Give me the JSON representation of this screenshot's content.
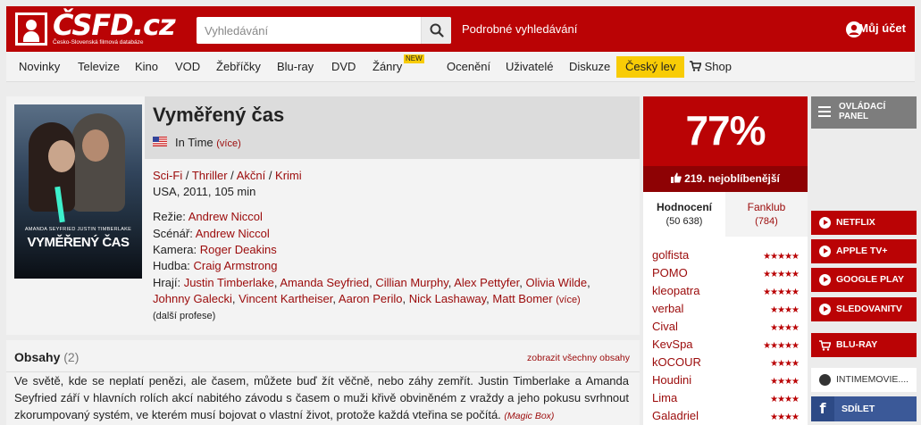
{
  "header": {
    "logo_text": "ČSFD.cz",
    "logo_sub": "Česko-Slovenská filmová databáze",
    "search_placeholder": "Vyhledávání",
    "advanced_search": "Podrobné vyhledávání",
    "account": "Můj účet"
  },
  "nav": {
    "items": [
      "Novinky",
      "Televize",
      "Kino",
      "VOD",
      "Žebříčky",
      "Blu-ray",
      "DVD",
      "Žánry",
      "Ocenění",
      "Uživatelé",
      "Diskuze",
      "Český lev",
      "Shop"
    ],
    "new_badge": "NEW"
  },
  "film": {
    "title": "Vyměřený čas",
    "original_title": "In Time",
    "more": "(více)",
    "genres": [
      "Sci-Fi",
      "Thriller",
      "Akční",
      "Krimi"
    ],
    "origin": "USA, 2011, 105 min",
    "poster_actors": "AMANDA SEYFRIED       JUSTIN TIMBERLAKE",
    "poster_title": "VYMĚŘENÝ ČAS",
    "crew": [
      {
        "role": "Režie:",
        "names": [
          "Andrew Niccol"
        ]
      },
      {
        "role": "Scénář:",
        "names": [
          "Andrew Niccol"
        ]
      },
      {
        "role": "Kamera:",
        "names": [
          "Roger Deakins"
        ]
      },
      {
        "role": "Hudba:",
        "names": [
          "Craig Armstrong"
        ]
      }
    ],
    "cast_label": "Hrají:",
    "cast": [
      "Justin Timberlake",
      "Amanda Seyfried",
      "Cillian Murphy",
      "Alex Pettyfer",
      "Olivia Wilde",
      "Johnny Galecki",
      "Vincent Kartheiser",
      "Aaron Perilo",
      "Nick Lashaway",
      "Matt Bomer"
    ],
    "cast_more": "(více)",
    "more_professions": "(další profese)"
  },
  "plot": {
    "title": "Obsahy",
    "count": "(2)",
    "show_all": "zobrazit všechny obsahy",
    "text": "Ve světě, kde se neplatí penězi, ale časem, můžete buď žít věčně, nebo záhy zemřít. Justin Timberlake a Amanda Seyfried září v hlavních rolích akcí nabitého závodu s časem o muži křivě obviněném z vraždy a jeho pokusu svrhnout zkorumpovaný systém, ve kterém musí bojovat o vlastní život, protože každá vteřina se počítá.",
    "source": "(Magic Box)"
  },
  "rating": {
    "score": "77%",
    "rank": "219. nejoblíbenější",
    "tabs": [
      {
        "label": "Hodnocení",
        "count": "(50 638)"
      },
      {
        "label": "Fanklub",
        "count": "(784)"
      }
    ],
    "users": [
      {
        "name": "golfista",
        "stars": 5
      },
      {
        "name": "POMO",
        "stars": 5
      },
      {
        "name": "kleopatra",
        "stars": 5
      },
      {
        "name": "verbal",
        "stars": 4
      },
      {
        "name": "Cival",
        "stars": 4
      },
      {
        "name": "KevSpa",
        "stars": 5
      },
      {
        "name": "kOCOUR",
        "stars": 4
      },
      {
        "name": "Houdini",
        "stars": 4
      },
      {
        "name": "Lima",
        "stars": 4
      },
      {
        "name": "Galadriel",
        "stars": 4
      }
    ]
  },
  "side": {
    "control_panel": "OVLÁDACÍ PANEL",
    "vod": [
      "NETFLIX",
      "APPLE TV+",
      "GOOGLE PLAY",
      "SLEDOVANITV"
    ],
    "bluray": "BLU-RAY",
    "intime": "INTIMEMOVIE....",
    "share": "SDÍLET"
  },
  "colors": {
    "brand_red": "#ba0305",
    "dark_red": "#8e0204",
    "link_red": "#9b0a0a",
    "highlight_yellow": "#f8cc06",
    "facebook": "#3b5998"
  }
}
